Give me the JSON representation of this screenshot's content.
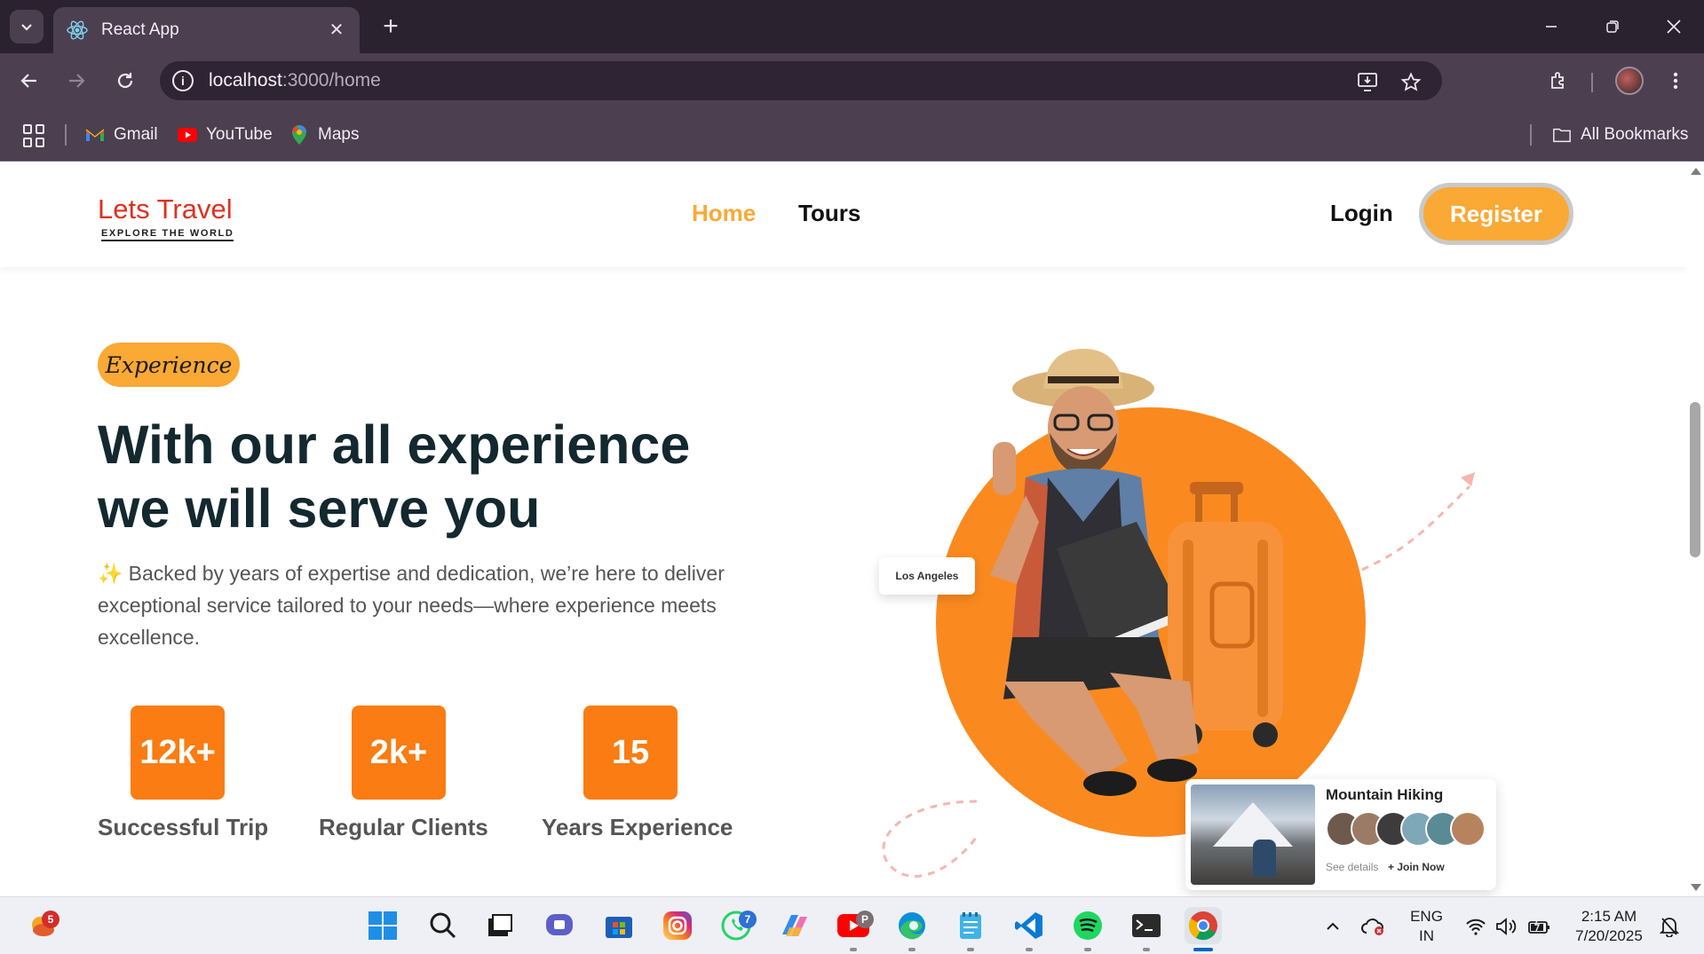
{
  "browser": {
    "tab_title": "React App",
    "url_host": "localhost",
    "url_rest": ":3000/home",
    "bookmarks": [
      {
        "label": "Gmail",
        "icon": "gmail-icon"
      },
      {
        "label": "YouTube",
        "icon": "youtube-icon"
      },
      {
        "label": "Maps",
        "icon": "maps-icon"
      }
    ],
    "all_bookmarks_label": "All Bookmarks"
  },
  "site": {
    "logo_main": "Lets Travel",
    "logo_sub": "EXPLORE THE WORLD",
    "nav": [
      {
        "label": "Home",
        "active": true
      },
      {
        "label": "Tours",
        "active": false
      }
    ],
    "login_label": "Login",
    "register_label": "Register"
  },
  "hero": {
    "pill": "Experience",
    "title_line1": "With our all experience",
    "title_line2": "we will serve you",
    "sparkle": "✨",
    "description": "Backed by years of expertise and dedication, we’re here to deliver exceptional service tailored to your needs—where experience meets excellence.",
    "stats": [
      {
        "value": "12k+",
        "label": "Successful Trip"
      },
      {
        "value": "2k+",
        "label": "Regular Clients"
      },
      {
        "value": "15",
        "label": "Years Experience"
      }
    ],
    "location_card": "Los Angeles",
    "activity_card": {
      "title": "Mountain Hiking",
      "see_details": "See details",
      "join_now": "+ Join Now"
    }
  },
  "colors": {
    "accent": "#faa935",
    "orange": "#fa7c12",
    "heading": "#13282f",
    "logo_red": "#e0301e"
  },
  "taskbar": {
    "weather_badge": "5",
    "whatsapp_badge": "7",
    "youtube_badge": "P",
    "lang_line1": "ENG",
    "lang_line2": "IN",
    "time": "2:15 AM",
    "date": "7/20/2025"
  }
}
